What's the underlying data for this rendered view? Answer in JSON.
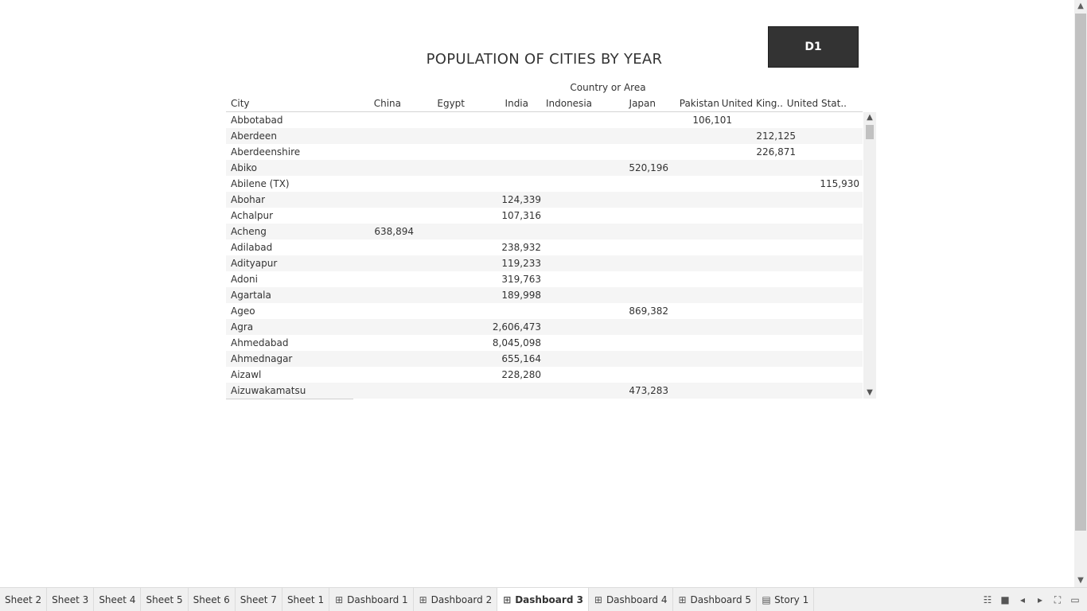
{
  "dashboard": {
    "button_label": "D1",
    "title": "POPULATION OF CITIES BY YEAR",
    "column_group_header": "Country or Area",
    "row_header": "City",
    "columns": [
      "China",
      "Egypt",
      "India",
      "Indonesia",
      "Japan",
      "Pakistan",
      "United King..",
      "United Stat.."
    ],
    "rows": [
      {
        "city": "Abbotabad",
        "values": [
          "",
          "",
          "",
          "",
          "",
          "106,101",
          "",
          ""
        ]
      },
      {
        "city": "Aberdeen",
        "values": [
          "",
          "",
          "",
          "",
          "",
          "",
          "212,125",
          ""
        ]
      },
      {
        "city": "Aberdeenshire",
        "values": [
          "",
          "",
          "",
          "",
          "",
          "",
          "226,871",
          ""
        ]
      },
      {
        "city": "Abiko",
        "values": [
          "",
          "",
          "",
          "",
          "520,196",
          "",
          "",
          ""
        ]
      },
      {
        "city": "Abilene (TX)",
        "values": [
          "",
          "",
          "",
          "",
          "",
          "",
          "",
          "115,930"
        ]
      },
      {
        "city": "Abohar",
        "values": [
          "",
          "",
          "124,339",
          "",
          "",
          "",
          "",
          ""
        ]
      },
      {
        "city": "Achalpur",
        "values": [
          "",
          "",
          "107,316",
          "",
          "",
          "",
          "",
          ""
        ]
      },
      {
        "city": "Acheng",
        "values": [
          "638,894",
          "",
          "",
          "",
          "",
          "",
          "",
          ""
        ]
      },
      {
        "city": "Adilabad",
        "values": [
          "",
          "",
          "238,932",
          "",
          "",
          "",
          "",
          ""
        ]
      },
      {
        "city": "Adityapur",
        "values": [
          "",
          "",
          "119,233",
          "",
          "",
          "",
          "",
          ""
        ]
      },
      {
        "city": "Adoni",
        "values": [
          "",
          "",
          "319,763",
          "",
          "",
          "",
          "",
          ""
        ]
      },
      {
        "city": "Agartala",
        "values": [
          "",
          "",
          "189,998",
          "",
          "",
          "",
          "",
          ""
        ]
      },
      {
        "city": "Ageo",
        "values": [
          "",
          "",
          "",
          "",
          "869,382",
          "",
          "",
          ""
        ]
      },
      {
        "city": "Agra",
        "values": [
          "",
          "",
          "2,606,473",
          "",
          "",
          "",
          "",
          ""
        ]
      },
      {
        "city": "Ahmedabad",
        "values": [
          "",
          "",
          "8,045,098",
          "",
          "",
          "",
          "",
          ""
        ]
      },
      {
        "city": "Ahmednagar",
        "values": [
          "",
          "",
          "655,164",
          "",
          "",
          "",
          "",
          ""
        ]
      },
      {
        "city": "Aizawl",
        "values": [
          "",
          "",
          "228,280",
          "",
          "",
          "",
          "",
          ""
        ]
      },
      {
        "city": "Aizuwakamatsu",
        "values": [
          "",
          "",
          "",
          "",
          "473,283",
          "",
          "",
          ""
        ]
      }
    ]
  },
  "tabs": [
    {
      "label": "Sheet 2",
      "icon": "",
      "active": false
    },
    {
      "label": "Sheet 3",
      "icon": "",
      "active": false
    },
    {
      "label": "Sheet 4",
      "icon": "",
      "active": false
    },
    {
      "label": "Sheet 5",
      "icon": "",
      "active": false
    },
    {
      "label": "Sheet 6",
      "icon": "",
      "active": false
    },
    {
      "label": "Sheet 7",
      "icon": "",
      "active": false
    },
    {
      "label": "Sheet 1",
      "icon": "",
      "active": false
    },
    {
      "label": "Dashboard 1",
      "icon": "dashboard-icon",
      "active": false
    },
    {
      "label": "Dashboard 2",
      "icon": "dashboard-icon",
      "active": false
    },
    {
      "label": "Dashboard 3",
      "icon": "dashboard-icon",
      "active": true
    },
    {
      "label": "Dashboard 4",
      "icon": "dashboard-icon",
      "active": false
    },
    {
      "label": "Dashboard 5",
      "icon": "dashboard-icon",
      "active": false
    },
    {
      "label": "Story 1",
      "icon": "story-icon",
      "active": false
    }
  ],
  "tab_controls": [
    "show-filmstrip-icon",
    "show-tabs-icon",
    "previous-sheet-icon",
    "next-sheet-icon",
    "fit-screen-icon",
    "presentation-mode-icon"
  ]
}
